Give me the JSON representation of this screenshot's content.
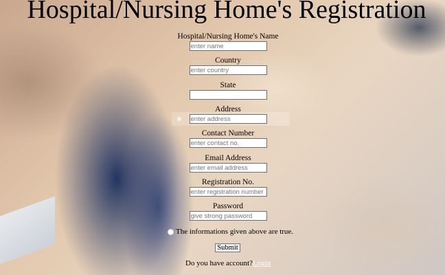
{
  "page": {
    "title": "Hospital/Nursing Home's Registration"
  },
  "form": {
    "fields": [
      {
        "label": "Hospital/Nursing Home's Name",
        "placeholder": "enter name",
        "value": ""
      },
      {
        "label": "Country",
        "placeholder": "enter country",
        "value": ""
      },
      {
        "label": "State",
        "placeholder": "",
        "value": ""
      },
      {
        "label": "Address",
        "placeholder": "enter address",
        "value": ""
      },
      {
        "label": "Contact Number",
        "placeholder": "enter contact no.",
        "value": ""
      },
      {
        "label": "Email Address",
        "placeholder": "enter email address",
        "value": ""
      },
      {
        "label": "Registration No.",
        "placeholder": "enter registration number",
        "value": ""
      },
      {
        "label": "Password",
        "placeholder": "give strong password",
        "value": ""
      }
    ],
    "agree_label": "The informations given above are true.",
    "submit_label": "Submit",
    "account_prompt": "Do you have account?",
    "login_link": "Login"
  }
}
